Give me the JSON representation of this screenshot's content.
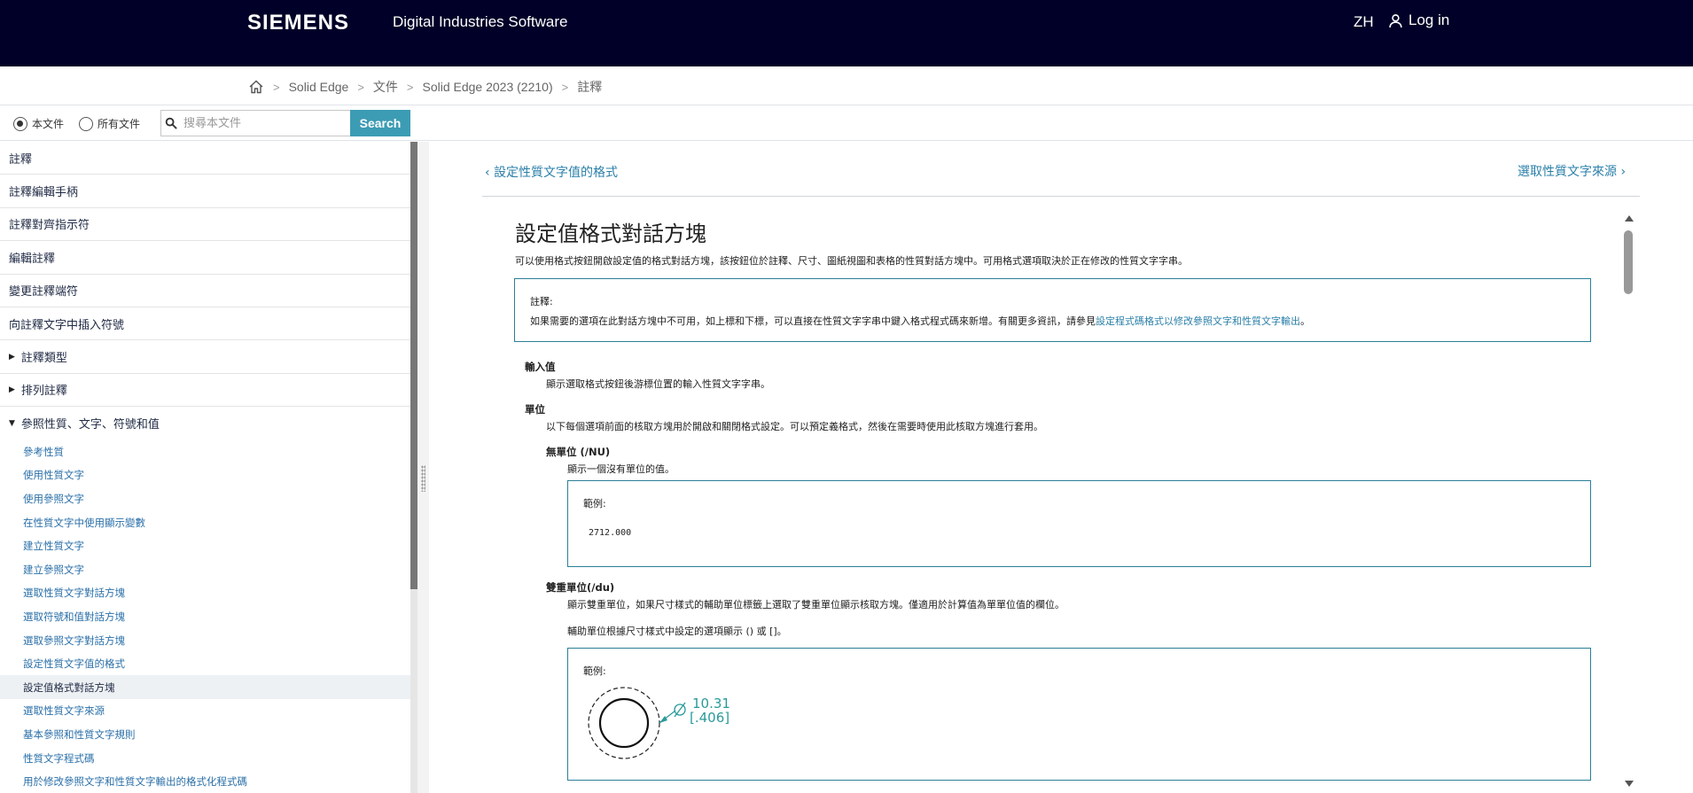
{
  "header": {
    "logo": "SIEMENS",
    "tagline": "Digital Industries Software",
    "lang": "ZH",
    "login": "Log in"
  },
  "breadcrumb": [
    "Solid Edge",
    "文件",
    "Solid Edge 2023 (2210)",
    "註釋"
  ],
  "search": {
    "radio_this": "本文件",
    "radio_all": "所有文件",
    "placeholder": "搜尋本文件",
    "button": "Search"
  },
  "sidebar": {
    "top": [
      "註釋",
      "註釋編輯手柄",
      "註釋對齊指示符",
      "編輯註釋",
      "變更註釋端符",
      "向註釋文字中插入符號"
    ],
    "collapsed": [
      "註釋類型",
      "排列註釋"
    ],
    "expanded": "參照性質、文字、符號和值",
    "sub": [
      "參考性質",
      "使用性質文字",
      "使用參照文字",
      "在性質文字中使用顯示變數",
      "建立性質文字",
      "建立參照文字",
      "選取性質文字對話方塊",
      "選取符號和值對話方塊",
      "選取參照文字對話方塊",
      "設定性質文字值的格式",
      "設定值格式對話方塊",
      "選取性質文字來源",
      "基本參照和性質文字規則",
      "性質文字程式碼",
      "用於修改參照文字和性質文字輸出的格式化程式碼"
    ]
  },
  "nav": {
    "prev": "設定性質文字值的格式",
    "next": "選取性質文字來源"
  },
  "doc": {
    "title": "設定值格式對話方塊",
    "intro": "可以使用格式按鈕開啟設定值的格式對話方塊，該按鈕位於註釋、尺寸、圖紙視圖和表格的性質對話方塊中。可用格式選項取決於正在修改的性質文字字串。",
    "note_label": "註釋:",
    "note_text": "如果需要的選項在此對話方塊中不可用，如上標和下標，可以直接在性質文字字串中鍵入格式程式碼來新增。有關更多資訊，請參見",
    "note_link": "設定程式碼格式以修改參照文字和性質文字輸出",
    "note_end": "。",
    "input_term": "輸入值",
    "input_def": "顯示選取格式按鈕後游標位置的輸入性質文字字串。",
    "unit_term": "單位",
    "unit_def": "以下每個選項前面的核取方塊用於開啟和關閉格式設定。可以預定義格式，然後在需要時使用此核取方塊進行套用。",
    "nu_term": "無單位 (/NU)",
    "nu_def": "顯示一個沒有單位的值。",
    "example_label": "範例:",
    "nu_example": "2712.000",
    "du_term": "雙重單位(/du)",
    "du_def": "顯示雙重單位，如果尺寸樣式的輔助單位標籤上選取了雙重單位顯示核取方塊。僅適用於計算值為單單位值的欄位。",
    "du_def2": "輔助單位根據尺寸樣式中設定的選項顯示 () 或 []。",
    "dim_primary": "10.31",
    "dim_secondary": "[.406]"
  }
}
